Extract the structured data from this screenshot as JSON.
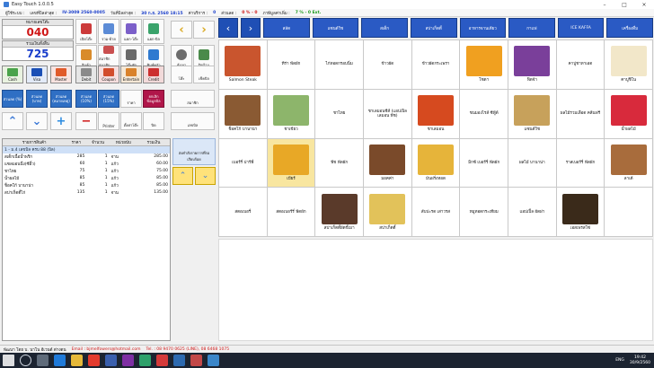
{
  "window": {
    "title": "Easy Touch 1.0.0.5"
  },
  "infobar": {
    "user_label": "ผู้ใช้ระบบ :",
    "bill_label": "เลขที่บิลล่าสุด :",
    "bill_no": "IV-3009 2560-0005",
    "date_label": "วันที่บิลล่าสุด :",
    "date_value": "30 ก.ย. 2560 18:15",
    "service_label": "ค่าบริการ :",
    "service_value": "0",
    "discount_label": "ส่วนลด :",
    "discount_value": "0  %  -  0",
    "vat_label": "ภาษีมูลค่าเพิ่ม :",
    "vat_value": "7  %  -  0  Ext."
  },
  "left": {
    "table_hdr": "หมายเลขโต๊ะ",
    "table_no": "040",
    "total_hdr": "รวมเงินทั้งสิ้น",
    "total": "725",
    "tool_buttons": [
      {
        "label": "เปิดโต๊ะ",
        "color": "#cc3a3a"
      },
      {
        "label": "รวม-ย้าย",
        "color": "#5b8bd6"
      },
      {
        "label": "แยก-โต๊ะ",
        "color": "#7b5fc9"
      },
      {
        "label": "แยก-บิล",
        "color": "#3aa36b"
      },
      {
        "label": "สินค้า",
        "color": "#d98b2b"
      },
      {
        "label": "สมาชิกสมาชิก",
        "color": "#c94f4f"
      },
      {
        "label": "โต๊ะพัก",
        "color": "#6b6b6b"
      },
      {
        "label": "พิมพ์ครัว",
        "color": "#2f7ad0"
      }
    ],
    "pay_buttons": [
      {
        "label": "Cash",
        "color": "#4aa34a",
        "bg": "#e9f2e0"
      },
      {
        "label": "Visa",
        "color": "#1a4fb5",
        "bg": "#e3ebf8"
      },
      {
        "label": "Master",
        "color": "#e05a2a",
        "bg": "#f8e3e0"
      },
      {
        "label": "Debit",
        "color": "#8a8a8a",
        "bg": "#e6e6e6"
      },
      {
        "label": "Coupon",
        "color": "#d24d2d",
        "bg": "#f5dede"
      },
      {
        "label": "Entertain",
        "color": "#d9822b",
        "bg": "#f5e8d6"
      },
      {
        "label": "Credit",
        "color": "#cc2f2f",
        "bg": "#f2dada"
      }
    ],
    "discount_buttons": [
      "ส่วนลด\n(%)",
      "ส่วนลด\n(บาท)",
      "ส่วนลด\n(หมายเหตุ)",
      "ส่วนลด\n(10%)",
      "ส่วนลด\n(15%)"
    ],
    "price_label": "ราคา",
    "cancel_label": "ยกเลิก\nข้อมูลบิล",
    "member_label": "สมาชิก",
    "print_label": "Printer",
    "setting_label": "ตั้งค่าโต๊ะ",
    "close_label": "ปิด",
    "log_label": "เลขบิล",
    "nav_labels": {
      "prev": "‹",
      "next": "›",
      "left_arrow": "โต๊ะ",
      "right_arrow": "เช็คบิล"
    },
    "items": {
      "headers": [
        "รายการสินค้า",
        "ราคา",
        "จำนวน",
        "หน่วยนับ",
        "รวมเงิน"
      ],
      "group": "1 - ม.4 เลขบิล ครบ 88 (บิล)",
      "rows": [
        [
          "สเต็กเนื้อน้ำพริก",
          "285",
          "1",
          "จาน",
          "285.00"
        ],
        [
          "แซลมอนนึ่ง(ซีอิ้ว)",
          "60",
          "1",
          "แก้ว",
          "60.00"
        ],
        [
          "ชาไทย",
          "75",
          "1",
          "แก้ว",
          "75.00"
        ],
        [
          "น้ำผลไม้",
          "85",
          "1",
          "แก้ว",
          "85.00"
        ],
        [
          "ช็อคโก้ บานาน่า",
          "85",
          "1",
          "แก้ว",
          "85.00"
        ],
        [
          "สปาเก็ตตี้ไก่",
          "135",
          "1",
          "จาน",
          "135.00"
        ]
      ]
    },
    "memo_label": "ส่งคำสั่งรายการที่รอเรียบร้อย"
  },
  "categories": [
    "สลัด",
    "แซนด์วิช",
    "สเต็ก",
    "สปาเก็ตตี้",
    "อาหารจานเดียว",
    "กาแฟ",
    "ICE KAFFA",
    "เครื่องดื่ม"
  ],
  "menu_grid": [
    {
      "name": "Salmon Steak",
      "img": "#c9552e"
    },
    {
      "name": "ทีร่า ฟัดผัก",
      "img": ""
    },
    {
      "name": "ไก่ทอดกรอบนิ่ม",
      "img": ""
    },
    {
      "name": "ข้าวผัด",
      "img": ""
    },
    {
      "name": "ข้าวผัดกระเพรา",
      "img": ""
    },
    {
      "name": "โซดา",
      "img": "#f0a020"
    },
    {
      "name": "ฟิตจ้า",
      "img": "#7a3f9a"
    },
    {
      "name": "คาปูชาทาเอด",
      "img": ""
    },
    {
      "name": "คาปูชิโน",
      "img": "#f2e7c9"
    },
    {
      "name": "ช็อคโก้ บานาน่า",
      "img": "#8a5a33"
    },
    {
      "name": "ชาเขียว",
      "img": "#8db56b"
    },
    {
      "name": "ชาไทย",
      "img": ""
    },
    {
      "name": "ชาเลมอนชีส์ (แอปเปิล เลมอน พีช)",
      "img": ""
    },
    {
      "name": "ชาเลมอน",
      "img": "#d64a1f"
    },
    {
      "name": "ชนมองไรส์ ซีฟู้ด์",
      "img": ""
    },
    {
      "name": "แซนด์วิช",
      "img": "#c7a15b"
    },
    {
      "name": "ผลไม้รวมเลือด คลีนฟรี",
      "img": ""
    },
    {
      "name": "น้ำผลไม้",
      "img": "#d82a3c"
    },
    {
      "name": "เบอร์รี่ ปาร์ฟี่",
      "img": ""
    },
    {
      "name": "เบียร์",
      "img": "#e8a826"
    },
    {
      "name": "พีช ฟัดผัก",
      "img": ""
    },
    {
      "name": "มอคค่า",
      "img": "#7a4a2a"
    },
    {
      "name": "มันฝรั่งทอด",
      "img": "#e6b43a"
    },
    {
      "name": "มิกซ์ เบอร์รี่ ฟัดผัก",
      "img": ""
    },
    {
      "name": "ผลไม้ บานาน่า",
      "img": ""
    },
    {
      "name": "ราสเบอร์รี่ ฟัดผัก",
      "img": ""
    },
    {
      "name": "ลาเต้",
      "img": "#a86c3c"
    },
    {
      "name": "สตอเบอรี่",
      "img": ""
    },
    {
      "name": "สตอเบอร์รี่ ฟัดผัก",
      "img": ""
    },
    {
      "name": "สปาเก็ตตี้ผัดขี้เมา",
      "img": "#5a3a2a"
    },
    {
      "name": "สปาเก็ตตี้",
      "img": "#e2c25a"
    },
    {
      "name": "สับปะรด เสาวรส",
      "img": ""
    },
    {
      "name": "หมูทอดกระเทียม",
      "img": ""
    },
    {
      "name": "แอปเปิ้ล ผัดฝา",
      "img": ""
    },
    {
      "name": "เอสเพรสโซ่",
      "img": "#3a2a1a"
    },
    {
      "name": "",
      "img": ""
    }
  ],
  "bottombar": {
    "address": "พัฒนา โดย บ. นาโน อีเวนต์ ต่างดน",
    "email_label": "Email : bjmelfowers@hotmail.com",
    "tel_label": "Tel. : 08 9470 0625 (LINE), 08 6468 1075"
  },
  "taskbar": {
    "time": "19:42",
    "date": "30/9/2560",
    "lang": "ENG"
  }
}
